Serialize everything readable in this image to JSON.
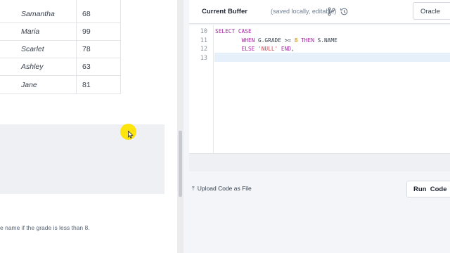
{
  "table": {
    "rows": [
      {
        "name": "Samantha",
        "grade": "68"
      },
      {
        "name": "Maria",
        "grade": "99"
      },
      {
        "name": "Scarlet",
        "grade": "78"
      },
      {
        "name": "Ashley",
        "grade": "63"
      },
      {
        "name": "Jane",
        "grade": "81"
      }
    ]
  },
  "problem": {
    "hint_fragment": "e name if the grade is less than 8."
  },
  "buffer": {
    "title": "Current Buffer",
    "subtitle": "(saved locally, editable)",
    "language": "Oracle"
  },
  "editor": {
    "line_numbers": [
      "10",
      "11",
      "12",
      "13"
    ],
    "lines": {
      "l10": {
        "kw1": "SELECT CASE"
      },
      "l11": {
        "kw1": "WHEN",
        "id1": "G.GRADE",
        "op": ">=",
        "num": "8",
        "kw2": "THEN",
        "id2": "S.NAME"
      },
      "l12": {
        "kw1": "ELSE",
        "str": "'NULL'",
        "kw2": "END",
        "tail": ","
      }
    },
    "active_line": "13"
  },
  "actions": {
    "upload_label": "Upload Code as File",
    "run_label": "Run  Code"
  },
  "icons": {
    "branch": "git-branch-icon",
    "history": "history-icon",
    "upload": "upload-icon",
    "cursor": "mouse-cursor-icon"
  },
  "colors": {
    "keyword": "#a626a4",
    "string": "#d3404e",
    "number": "#c18401",
    "cursor_highlight": "#fde300",
    "active_line": "#e6f0fb"
  }
}
